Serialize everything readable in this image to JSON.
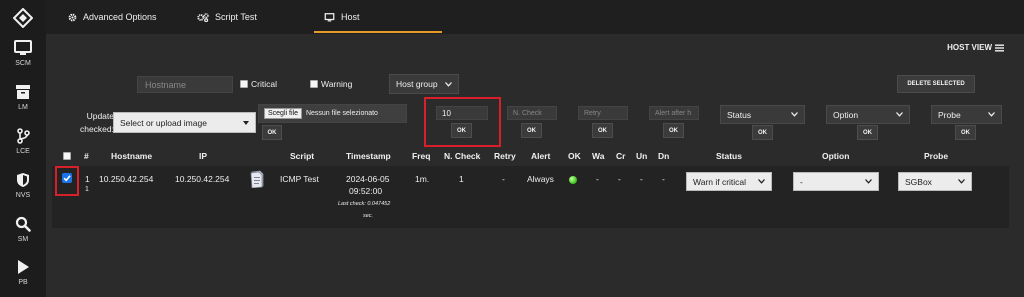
{
  "sidebar": {
    "logo_icon": "diamond-logo-icon",
    "items": [
      {
        "label": "SCM",
        "icon": "monitor-icon"
      },
      {
        "label": "LM",
        "icon": "archive-icon"
      },
      {
        "label": "LCE",
        "icon": "branch-icon"
      },
      {
        "label": "NVS",
        "icon": "shield-icon"
      },
      {
        "label": "SM",
        "icon": "search-icon"
      },
      {
        "label": "PB",
        "icon": "play-icon"
      }
    ]
  },
  "tabs": [
    {
      "label": "Advanced Options",
      "icon": "gear-icon"
    },
    {
      "label": "Script Test",
      "icon": "gears-icon"
    },
    {
      "label": "Host",
      "icon": "monitor-icon"
    }
  ],
  "main": {
    "host_view_label": "HOST VIEW",
    "filters": {
      "hostname_placeholder": "Hostname",
      "critical_label": "Critical",
      "warning_label": "Warning",
      "host_group_label": "Host group",
      "delete_selected_label": "DELETE SELECTED"
    },
    "update": {
      "label_line1": "Update",
      "label_line2": "checked:",
      "image_select": "Select or upload image",
      "file_button": "Scegli file",
      "file_status": "Nessun file selezionato",
      "freq_value": "10",
      "n_check_placeholder": "N. Check",
      "retry_placeholder": "Retry",
      "alert_after_placeholder": "Alert after h",
      "status_select": "Status",
      "option_select": "Option",
      "probe_select": "Probe",
      "ok_label": "OK"
    },
    "table": {
      "headers": [
        "#",
        "Hostname",
        "IP",
        "Script",
        "Timestamp",
        "Freq",
        "N. Check",
        "Retry",
        "Alert",
        "OK",
        "Wa",
        "Cr",
        "Un",
        "Dn",
        "Status",
        "Option",
        "Probe"
      ],
      "rows": [
        {
          "num_line1": "1",
          "num_line2": "1",
          "hostname": "10.250.42.254",
          "ip": "10.250.42.254",
          "script": "ICMP Test",
          "timestamp_date": "2024-06-05",
          "timestamp_time": "09:52:00",
          "last_check_line1": "Last check: 0.047452",
          "last_check_line2": "sec.",
          "freq": "1m.",
          "n_check": "1",
          "retry": "-",
          "alert": "Always",
          "wa": "-",
          "cr": "-",
          "un": "-",
          "dn": "-",
          "status": "Warn if critical",
          "option": "-",
          "probe": "SGBox"
        }
      ]
    }
  },
  "colors": {
    "accent": "#e69a2a",
    "highlight": "#d8202a",
    "ok_dot": "#4cd12b"
  }
}
